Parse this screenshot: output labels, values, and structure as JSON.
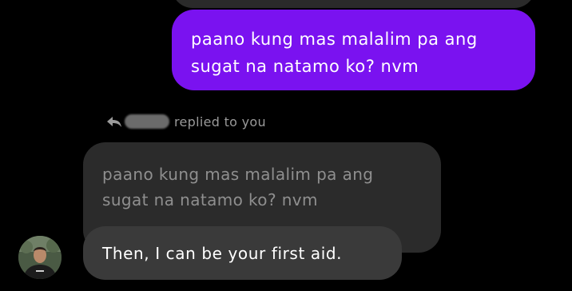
{
  "messages": {
    "sent_text": "paano kung mas malalim pa ang sugat na natamo ko? nvm",
    "reply_indicator": "replied to you",
    "quoted_text": "paano kung mas malalim pa ang sugat na natamo ko? nvm",
    "received_text": "Then, I can be your first aid."
  },
  "icons": {
    "reply": "reply-arrow-icon",
    "avatar": "profile-photo"
  },
  "colors": {
    "background": "#000000",
    "sent_bubble": "#7a12f0",
    "received_bubble": "#3a3a3a",
    "quoted_bubble": "#2b2b2b"
  }
}
